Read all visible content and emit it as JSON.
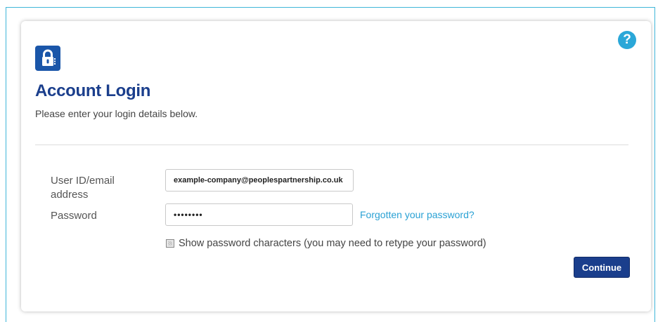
{
  "login": {
    "title": "Account Login",
    "subtitle": "Please enter your login details below.",
    "user_label": "User ID/email address",
    "user_value": "example-company@peoplespartnership.co.uk",
    "password_label": "Password",
    "password_value": "••••••••",
    "forgot_link": "Forgotten your password?",
    "show_password_label": "Show password characters (you may need to retype your password)",
    "continue_label": "Continue",
    "help_glyph": "?"
  },
  "icons": {
    "help": "help-icon",
    "lock": "lock-icon"
  },
  "colors": {
    "title": "#1a3e8c",
    "link": "#2aa1d4",
    "help": "#2aa7d8",
    "button": "#1a3e8c",
    "frame": "#3fb6d9"
  }
}
